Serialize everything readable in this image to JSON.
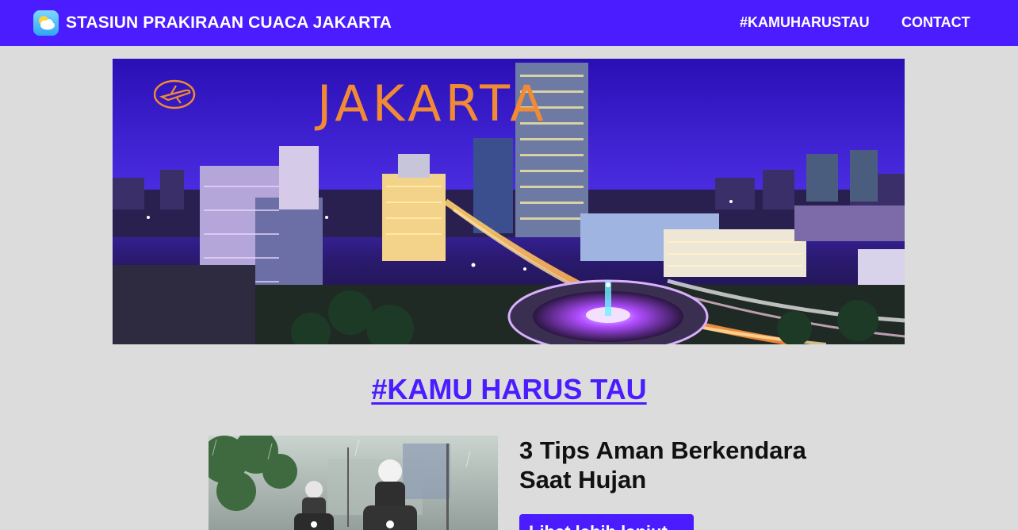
{
  "navbar": {
    "brand_icon": "weather-sun-cloud-icon",
    "brand_title": "STASIUN PRAKIRAAN CUACA JAKARTA",
    "links": [
      "#KAMUHARUSTAU",
      "CONTACT"
    ]
  },
  "hero": {
    "image": "jakarta-night-skyline-photo",
    "overlay_text": "JAKARTA",
    "overlay_icon": "airplane-icon"
  },
  "section": {
    "heading": "#KAMU HARUS TAU"
  },
  "article": {
    "image": "motorcyclists-riding-in-rain-photo",
    "title": "3 Tips Aman Berkendara Saat Hujan",
    "button_label": "Lihat lebih lanjut"
  },
  "colors": {
    "primary": "#4a1cff",
    "background": "#dcdcdc",
    "hero_text": "#f08a34"
  }
}
